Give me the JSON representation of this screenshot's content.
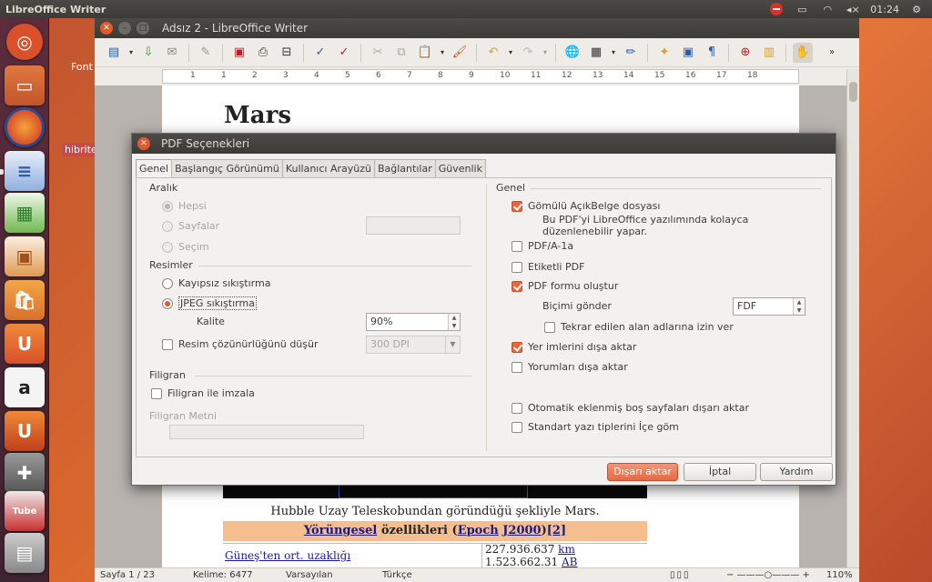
{
  "top_panel": {
    "app_name": "LibreOffice Writer",
    "clock": "01:24"
  },
  "desktop": {
    "label_fonts": "Font",
    "label_hibrite": "hibrite"
  },
  "writer": {
    "title": "Adsız 2 - LibreOffice Writer",
    "ruler_numbers": [
      "1",
      "1",
      "2",
      "3",
      "4",
      "5",
      "6",
      "7",
      "8",
      "9",
      "10",
      "11",
      "12",
      "13",
      "14",
      "15",
      "16",
      "17",
      "18"
    ],
    "doc": {
      "heading": "Mars",
      "caption": "Hubble Uzay Teleskobundan göründüğü şekliyle Mars.",
      "orbit_a": "Yörüngesel",
      "orbit_b": " özellikleri (",
      "orbit_c": "Epoch",
      "orbit_d": " ",
      "orbit_e": "J2000",
      "orbit_f": ")",
      "orbit_g": "[2]",
      "row_label": "Güneş'ten ort. uzaklığı",
      "row_value_1": "227.936.637",
      "row_value_1_unit": "km",
      "row_value_2": "1.523.662.31",
      "row_value_2_unit": "AB"
    },
    "status": {
      "page": "Sayfa 1 / 23",
      "words": "Kelime: 6477",
      "style": "Varsayılan",
      "lang": "Türkçe",
      "zoom": "110%"
    }
  },
  "dialog": {
    "title": "PDF Seçenekleri",
    "tabs": [
      "Genel",
      "Başlangıç Görünümü",
      "Kullanıcı Arayüzü",
      "Bağlantılar",
      "Güvenlik"
    ],
    "left": {
      "range_title": "Aralık",
      "all": "Hepsi",
      "pages": "Sayfalar",
      "selection": "Seçim",
      "images_title": "Resimler",
      "lossless": "Kayıpsız sıkıştırma",
      "jpeg": "JPEG sıkıştırma",
      "quality_label": "Kalite",
      "quality_value": "90%",
      "reduce_res": "Resim çözünürlüğünü düşür",
      "dpi_value": "300 DPI",
      "watermark_title": "Filigran",
      "sign_watermark": "Filigran ile imzala",
      "watermark_text_label": "Filigran Metni"
    },
    "right": {
      "general_title": "Genel",
      "embed_odf": "Gömülü AçıkBelge dosyası",
      "embed_note_1": "Bu PDF'yi LibreOffice yazılımında kolayca",
      "embed_note_2": "düzenlenebilir yapar.",
      "pdfa": "PDF/A-1a",
      "tagged": "Etiketli PDF",
      "create_form": "PDF formu oluştur",
      "submit_format_label": "Biçimi gönder",
      "submit_format_value": "FDF",
      "allow_dup_names": "Tekrar edilen alan adlarına izin ver",
      "export_bookmarks": "Yer imlerini dışa aktar",
      "export_comments": "Yorumları dışa aktar",
      "export_blank": "Otomatik eklenmiş boş sayfaları dışarı aktar",
      "embed_fonts": "Standart yazı tiplerini İçe göm"
    },
    "buttons": {
      "export": "Dışarı aktar",
      "cancel": "İptal",
      "help": "Yardım"
    }
  },
  "colors": {
    "accent": "#e25a2a",
    "panel": "#3c3b37"
  }
}
